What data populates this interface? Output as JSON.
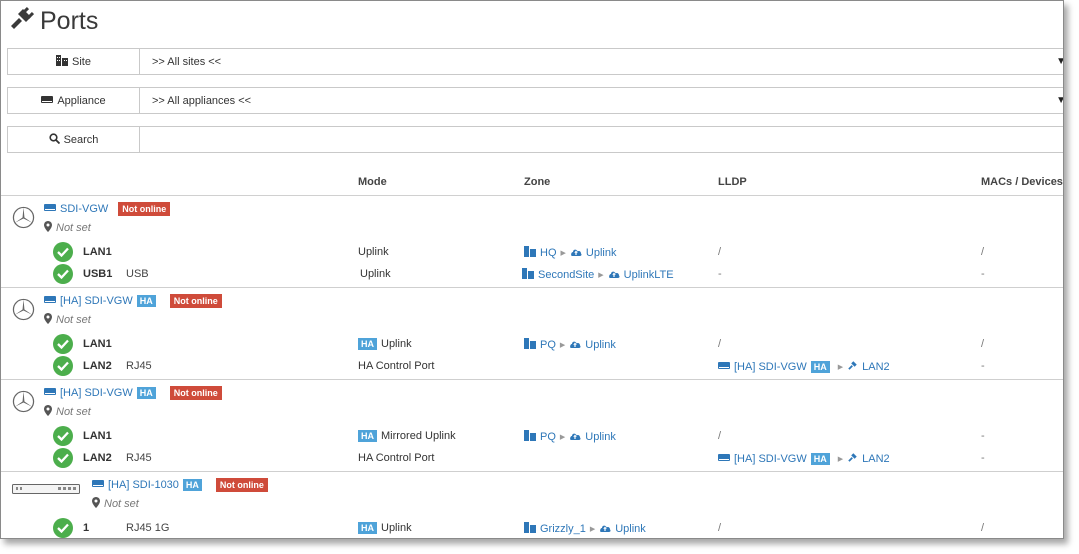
{
  "page": {
    "title": "Ports",
    "title_icon": "plug-icon"
  },
  "filters": {
    "site": {
      "label": "Site",
      "icon": "building-icon",
      "value": ">> All sites <<"
    },
    "appliance": {
      "label": "Appliance",
      "icon": "appliance-icon",
      "value": ">> All appliances <<"
    },
    "search": {
      "label": "Search",
      "icon": "search-icon",
      "value": ""
    }
  },
  "columns": {
    "mode": "Mode",
    "zone": "Zone",
    "lldp": "LLDP",
    "macs": "MACs / Devices"
  },
  "groups": [
    {
      "name": "SDI-VGW",
      "ha": "",
      "status": "Not online",
      "location": "Not set",
      "device_icon": "mercedes-logo-icon",
      "ports": [
        {
          "name": "LAN1",
          "type": "",
          "mode_badge": "",
          "mode": "Uplink",
          "zone_site": "HQ",
          "zone_uplink": "Uplink",
          "lldp_text": "/",
          "lldp_device": "",
          "lldp_ha": "",
          "lldp_port": "",
          "macs": "/"
        },
        {
          "name": "USB1",
          "type": "USB",
          "mode_badge": "",
          "mode": "Uplink",
          "zone_site": "SecondSite",
          "zone_uplink": "UplinkLTE",
          "lldp_text": "-",
          "lldp_device": "",
          "lldp_ha": "",
          "lldp_port": "",
          "macs": "-"
        }
      ]
    },
    {
      "name": "[HA] SDI-VGW",
      "ha": "HA",
      "status": "Not online",
      "location": "Not set",
      "device_icon": "mercedes-logo-icon",
      "ports": [
        {
          "name": "LAN1",
          "type": "",
          "mode_badge": "HA",
          "mode": "Uplink",
          "zone_site": "PQ",
          "zone_uplink": "Uplink",
          "lldp_text": "/",
          "lldp_device": "",
          "lldp_ha": "",
          "lldp_port": "",
          "macs": "/"
        },
        {
          "name": "LAN2",
          "type": "RJ45",
          "mode_badge": "",
          "mode": "HA Control Port",
          "zone_site": "",
          "zone_uplink": "",
          "lldp_text": "",
          "lldp_device": "[HA] SDI-VGW",
          "lldp_ha": "HA",
          "lldp_port": "LAN2",
          "macs": "-"
        }
      ]
    },
    {
      "name": "[HA] SDI-VGW",
      "ha": "HA",
      "status": "Not online",
      "location": "Not set",
      "device_icon": "mercedes-logo-icon",
      "ports": [
        {
          "name": "LAN1",
          "type": "",
          "mode_badge": "HA",
          "mode": "Mirrored Uplink",
          "zone_site": "PQ",
          "zone_uplink": "Uplink",
          "lldp_text": "/",
          "lldp_device": "",
          "lldp_ha": "",
          "lldp_port": "",
          "macs": "-"
        },
        {
          "name": "LAN2",
          "type": "RJ45",
          "mode_badge": "",
          "mode": "HA Control Port",
          "zone_site": "",
          "zone_uplink": "",
          "lldp_text": "",
          "lldp_device": "[HA] SDI-VGW",
          "lldp_ha": "HA",
          "lldp_port": "LAN2",
          "macs": "-"
        }
      ]
    },
    {
      "name": "[HA] SDI-1030",
      "ha": "HA",
      "status": "Not online",
      "location": "Not set",
      "device_icon": "rack-appliance-icon",
      "ports": [
        {
          "name": "1",
          "type": "RJ45 1G",
          "mode_badge": "HA",
          "mode": "Uplink",
          "zone_site": "Grizzly_1",
          "zone_uplink": "Uplink",
          "lldp_text": "/",
          "lldp_device": "",
          "lldp_ha": "",
          "lldp_port": "",
          "macs": "/"
        }
      ]
    }
  ],
  "colors": {
    "link": "#2e77b8",
    "ok_green": "#4cae4c",
    "offline_red": "#cf4b3a",
    "ha_blue": "#4fa3d9"
  }
}
